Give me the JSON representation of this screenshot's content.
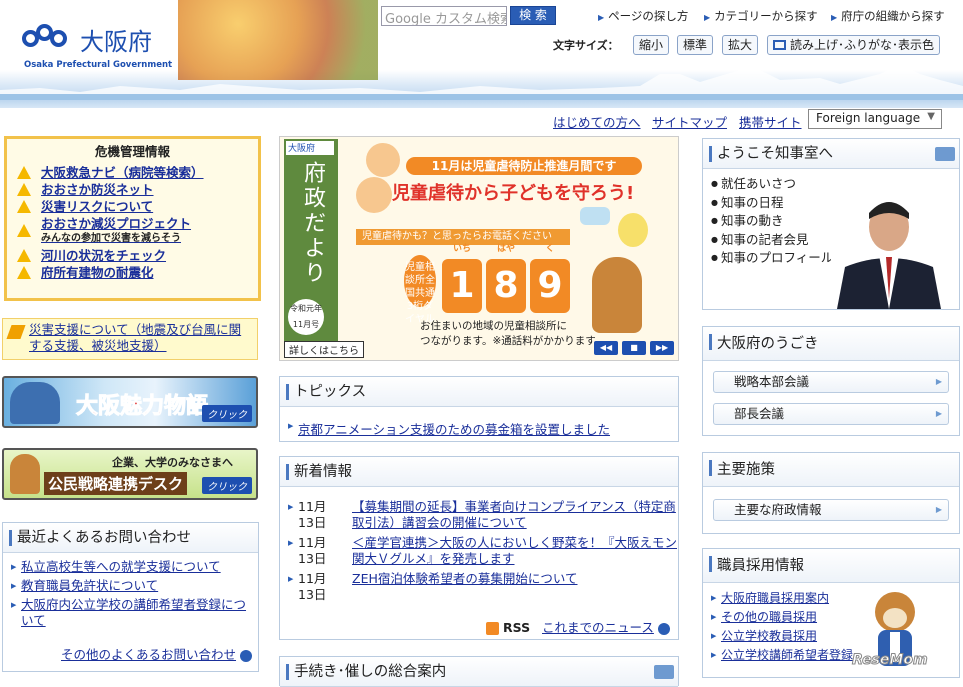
{
  "header": {
    "logo_title": "大阪府",
    "logo_sub": "Osaka Prefectural Government",
    "search_placeholder": "Google カスタム検索",
    "search_button": "検 索",
    "topnav": [
      "ページの探し方",
      "カテゴリーから探す",
      "府庁の組織から探す"
    ],
    "font_size_label": "文字サイズ：",
    "font_sizes": [
      "縮小",
      "標準",
      "拡大"
    ],
    "read_aloud": "読み上げ･ふりがな･表示色",
    "subnav": [
      "はじめての方へ",
      "サイトマップ",
      "携帯サイト"
    ],
    "foreign_language": "Foreign language"
  },
  "crisis": {
    "title": "危機管理情報",
    "items": [
      "大阪救急ナビ（病院等検索）",
      "おおさか防災ネット",
      "災害リスクについて",
      "おおさか減災プロジェクト",
      "河川の状況をチェック",
      "府所有建物の耐震化"
    ],
    "sub_note": "みんなの参加で災害を減らそう"
  },
  "disaster_support": "災害支援について（地震及び台風に関する支援、被災地支援）",
  "banners": {
    "miryoku": "大阪魅力物語",
    "click": "クリック",
    "kouminn_top": "企業、大学のみなさまへ",
    "kouminn_main": "公民戦略連携デスク"
  },
  "faq": {
    "title": "最近よくあるお問い合わせ",
    "items": [
      "私立高校生等への就学支援について",
      "教育職員免許状について",
      "大阪府内公立学校の講師希望者登録について"
    ],
    "more": "その他のよくあるお問い合わせ"
  },
  "feature": {
    "brand": "大阪府",
    "vertical_title": "府政だより",
    "issue": "令和元年 11月号",
    "headline_month": "11月は児童虐待防止推進月間です",
    "headline": "児童虐待から子どもを守ろう!",
    "call_prompt": "児童虐待かも？と思ったらお電話ください",
    "dial_label": "児童相談所全国共通3桁ダイヤル",
    "digits": [
      "1",
      "8",
      "9"
    ],
    "digit_reads": [
      "いち",
      "はや",
      "く"
    ],
    "note": "お住まいの地域の児童相談所に\nつながります。※通話料がかかります。",
    "detail": "詳しくはこちら"
  },
  "topics": {
    "title": "トピックス",
    "items": [
      "京都アニメーション支援のための募金箱を設置しました"
    ]
  },
  "news": {
    "title": "新着情報",
    "items": [
      {
        "date": "11月13日",
        "text": "【募集期間の延長】事業者向けコンプライアンス（特定商取引法）講習会の開催について"
      },
      {
        "date": "11月13日",
        "text": "＜産学官連携＞大阪の人においしく野菜を！『大阪えモン 関大Ｖグルメ』を発売します"
      },
      {
        "date": "11月13日",
        "text": "ZEH宿泊体験希望者の募集開始について"
      }
    ],
    "rss": "RSS",
    "more": "これまでのニュース"
  },
  "procedures": {
    "title": "手続き･催しの総合案内"
  },
  "welcome": {
    "title": "ようこそ知事室へ",
    "items": [
      "就任あいさつ",
      "知事の日程",
      "知事の動き",
      "知事の記者会見",
      "知事のプロフィール"
    ]
  },
  "ugoki": {
    "title": "大阪府のうごき",
    "items": [
      "戦略本部会議",
      "部長会議"
    ]
  },
  "policy": {
    "title": "主要施策",
    "items": [
      "主要な府政情報"
    ]
  },
  "recruit": {
    "title": "職員採用情報",
    "items": [
      "大阪府職員採用案内",
      "その他の職員採用",
      "公立学校教員採用",
      "公立学校講師希望者登録"
    ]
  },
  "watermark": "ReseMom"
}
